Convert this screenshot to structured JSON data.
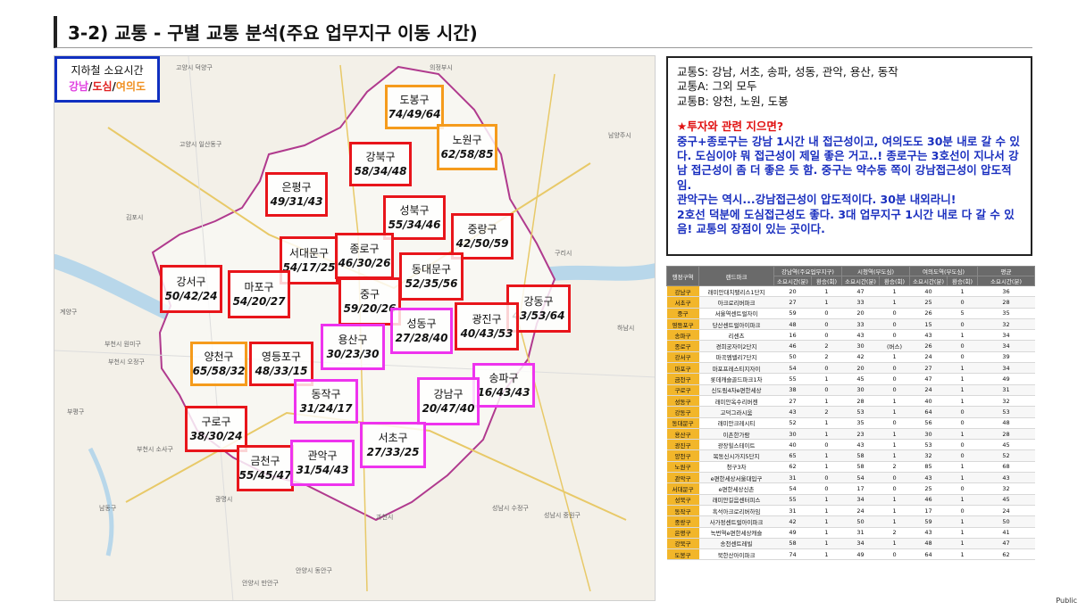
{
  "title": "3-2) 교통 - 구별 교통 분석(주요 업무지구 이동 시간)",
  "legend": {
    "line1": "지하철 소요시간",
    "gangnam": "강남",
    "slash": "/",
    "dosim": "도심",
    "yeouido": "여의도"
  },
  "districts": [
    {
      "name": "도봉구",
      "values": "74/49/64",
      "color": "orange"
    },
    {
      "name": "노원구",
      "values": "62/58/85",
      "color": "orange"
    },
    {
      "name": "강북구",
      "values": "58/34/48",
      "color": "red"
    },
    {
      "name": "은평구",
      "values": "49/31/43",
      "color": "red"
    },
    {
      "name": "성북구",
      "values": "55/34/46",
      "color": "red"
    },
    {
      "name": "중랑구",
      "values": "42/50/59",
      "color": "red"
    },
    {
      "name": "서대문구",
      "values": "54/17/25",
      "color": "red"
    },
    {
      "name": "종로구",
      "values": "46/30/26",
      "color": "red"
    },
    {
      "name": "동대문구",
      "values": "52/35/56",
      "color": "red"
    },
    {
      "name": "강서구",
      "values": "50/42/24",
      "color": "red"
    },
    {
      "name": "마포구",
      "values": "54/20/27",
      "color": "red"
    },
    {
      "name": "중구",
      "values": "59/20/26",
      "color": "red"
    },
    {
      "name": "강동구",
      "values": "43/53/64",
      "color": "red"
    },
    {
      "name": "성동구",
      "values": "27/28/40",
      "color": "pink"
    },
    {
      "name": "광진구",
      "values": "40/43/53",
      "color": "red"
    },
    {
      "name": "용산구",
      "values": "30/23/30",
      "color": "pink"
    },
    {
      "name": "양천구",
      "values": "65/58/32",
      "color": "orange"
    },
    {
      "name": "영등포구",
      "values": "48/33/15",
      "color": "red"
    },
    {
      "name": "송파구",
      "values": "16/43/43",
      "color": "pink"
    },
    {
      "name": "동작구",
      "values": "31/24/17",
      "color": "pink"
    },
    {
      "name": "강남구",
      "values": "20/47/40",
      "color": "pink"
    },
    {
      "name": "구로구",
      "values": "38/30/24",
      "color": "red"
    },
    {
      "name": "서초구",
      "values": "27/33/25",
      "color": "pink"
    },
    {
      "name": "금천구",
      "values": "55/45/47",
      "color": "red"
    },
    {
      "name": "관악구",
      "values": "31/54/43",
      "color": "pink"
    }
  ],
  "places": [
    "고양시 덕양구",
    "의정부시",
    "남양주시",
    "고양시 일산동구",
    "구리시",
    "김포시",
    "계양구",
    "부천시 원미구",
    "부천시 오정구",
    "광명시",
    "부평구",
    "부천시 소사구",
    "성남시 수정구",
    "성남시 중원구",
    "과천시",
    "안양시 동안구",
    "안양시 만안구",
    "남동구",
    "하남시"
  ],
  "info": {
    "line_s": "교통S: 강남, 서초, 송파, 성동, 관악, 용산, 동작",
    "line_a": "교통A: 그외 모두",
    "line_b": "교통B: 양천, 노원, 도봉",
    "head": "★투자와 관련 지으면?",
    "p1": "중구+종로구는 강남 1시간 내 접근성이고, 여의도도 30분 내로 갈 수 있다. 도심이야 뭐 접근성이 제일 좋은 거고..! 종로구는 3호선이 지나서 강남 접근성이 좀 더 좋은 듯 함. 중구는 약수동 쪽이 강남접근성이 압도적임.",
    "p2": "관악구는 역시...강남접근성이 압도적이다. 30분 내외라니!",
    "p3": "2호선 덕분에 도심접근성도 좋다. 3대 업무지구 1시간 내로 다 갈 수 있음! 교통의 장점이 있는 곳이다."
  },
  "table": {
    "head1": [
      "행정구역",
      "랜드마크",
      "강남역(주요업무지구)",
      "시청역(부도심)",
      "여의도역(부도심)",
      "평균"
    ],
    "head2": [
      "소요시간(분)",
      "환승(회)",
      "소요시간(분)",
      "환승(회)",
      "소요시간(분)",
      "환승(회)",
      "소요시간(분)"
    ],
    "rows": [
      [
        "강남구",
        "래미안대치팰리스1단지",
        "20",
        "1",
        "47",
        "1",
        "40",
        "1",
        "36"
      ],
      [
        "서초구",
        "아크로리버파크",
        "27",
        "1",
        "33",
        "1",
        "25",
        "0",
        "28"
      ],
      [
        "중구",
        "서울역센트럴자이",
        "59",
        "0",
        "20",
        "0",
        "26",
        "5",
        "35"
      ],
      [
        "영등포구",
        "당산센트럴아이파크",
        "48",
        "0",
        "33",
        "0",
        "15",
        "0",
        "32"
      ],
      [
        "송파구",
        "리센츠",
        "16",
        "0",
        "43",
        "0",
        "43",
        "1",
        "34"
      ],
      [
        "종로구",
        "경희궁자이2단지",
        "46",
        "2",
        "30",
        "(버스)",
        "26",
        "0",
        "34"
      ],
      [
        "강서구",
        "마곡엠밸리7단지",
        "50",
        "2",
        "42",
        "1",
        "24",
        "0",
        "39"
      ],
      [
        "마포구",
        "마포프레스티지자이",
        "54",
        "0",
        "20",
        "0",
        "27",
        "1",
        "34"
      ],
      [
        "금천구",
        "롯데캐슬골드파크1차",
        "55",
        "1",
        "45",
        "0",
        "47",
        "1",
        "49"
      ],
      [
        "구로구",
        "신도림4차e편한세상",
        "38",
        "0",
        "30",
        "0",
        "24",
        "1",
        "31"
      ],
      [
        "성동구",
        "래미안옥수리버젠",
        "27",
        "1",
        "28",
        "1",
        "40",
        "1",
        "32"
      ],
      [
        "강동구",
        "고덕그라시움",
        "43",
        "2",
        "53",
        "1",
        "64",
        "0",
        "53"
      ],
      [
        "동대문구",
        "래미안크레시티",
        "52",
        "1",
        "35",
        "0",
        "56",
        "0",
        "48"
      ],
      [
        "용산구",
        "이촌한가람",
        "30",
        "1",
        "23",
        "1",
        "30",
        "1",
        "28"
      ],
      [
        "광진구",
        "광장힐스테이트",
        "40",
        "0",
        "43",
        "1",
        "53",
        "0",
        "45"
      ],
      [
        "양천구",
        "목동신시가지5단지",
        "65",
        "1",
        "58",
        "1",
        "32",
        "0",
        "52"
      ],
      [
        "노원구",
        "청구3차",
        "62",
        "1",
        "58",
        "2",
        "85",
        "1",
        "68"
      ],
      [
        "관악구",
        "e편한세상서울대입구",
        "31",
        "0",
        "54",
        "0",
        "43",
        "1",
        "43"
      ],
      [
        "서대문구",
        "e편한세상신촌",
        "54",
        "0",
        "17",
        "0",
        "25",
        "0",
        "32"
      ],
      [
        "성북구",
        "래미안길음센터피스",
        "55",
        "1",
        "34",
        "1",
        "46",
        "1",
        "45"
      ],
      [
        "동작구",
        "흑석아크로리버하임",
        "31",
        "1",
        "24",
        "1",
        "17",
        "0",
        "24"
      ],
      [
        "중랑구",
        "사가정센트럴아이파크",
        "42",
        "1",
        "50",
        "1",
        "59",
        "1",
        "50"
      ],
      [
        "은평구",
        "녹번역e편한세상캐슬",
        "49",
        "1",
        "31",
        "2",
        "43",
        "1",
        "41"
      ],
      [
        "강북구",
        "송천센트레빌",
        "58",
        "1",
        "34",
        "1",
        "48",
        "1",
        "47"
      ],
      [
        "도봉구",
        "북한산아이파크",
        "74",
        "1",
        "49",
        "0",
        "64",
        "1",
        "62"
      ]
    ]
  },
  "footer": "Public"
}
